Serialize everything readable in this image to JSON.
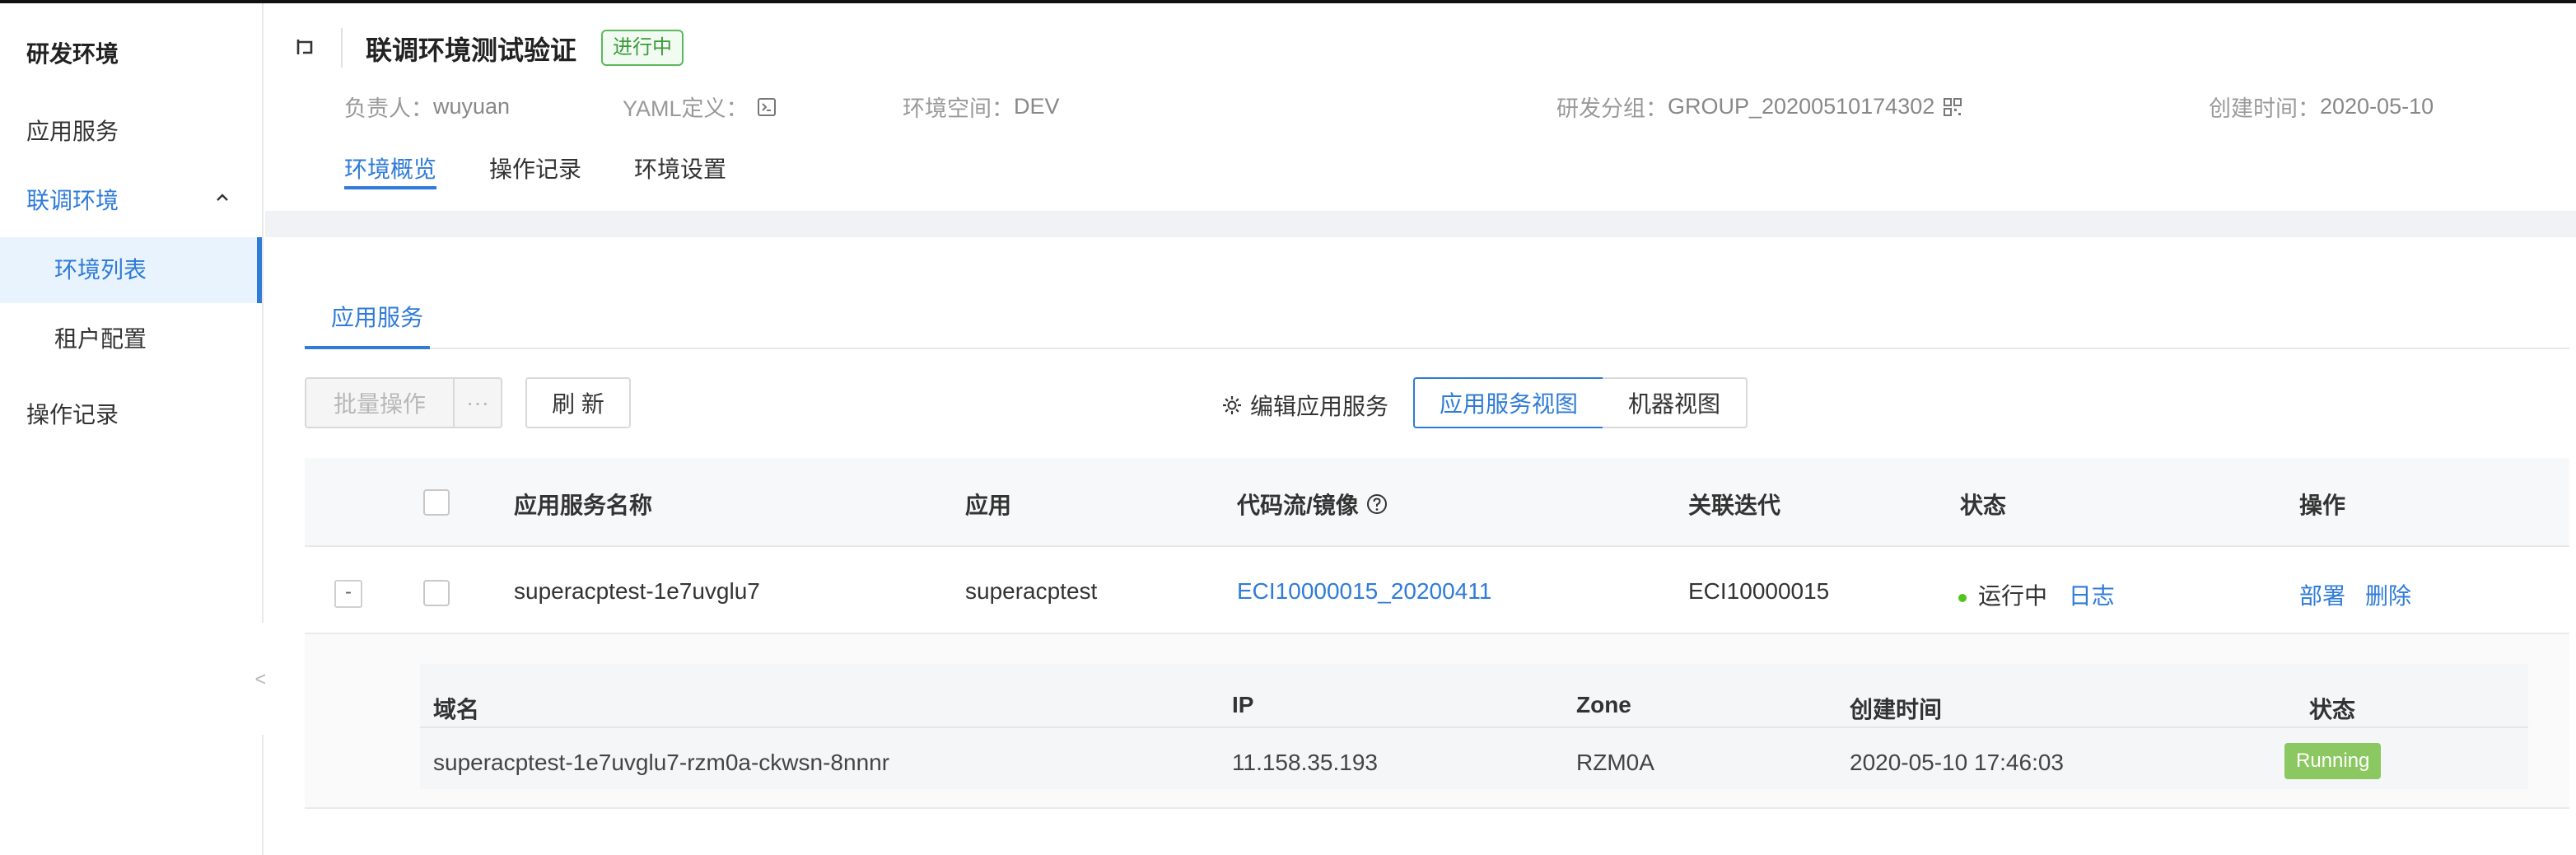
{
  "sidebar": {
    "title": "研发环境",
    "items": [
      {
        "label": "应用服务"
      },
      {
        "label": "联调环境"
      },
      {
        "label": "环境列表"
      },
      {
        "label": "租户配置"
      },
      {
        "label": "操作记录"
      }
    ],
    "collapse_glyph": "<"
  },
  "header": {
    "title": "联调环境测试验证",
    "status": "进行中",
    "meta": {
      "owner_label": "负责人：",
      "owner_value": "wuyuan",
      "yaml_label": "YAML定义：",
      "space_label": "环境空间：",
      "space_value": "DEV",
      "group_label": "研发分组：",
      "group_value": "GROUP_20200510174302",
      "created_label": "创建时间：",
      "created_value": "2020-05-10"
    },
    "tabs": [
      {
        "label": "环境概览"
      },
      {
        "label": "操作记录"
      },
      {
        "label": "环境设置"
      }
    ]
  },
  "content": {
    "sub_tab": "应用服务",
    "toolbar": {
      "batch_label": "批量操作",
      "more_label": "···",
      "refresh_label": "刷 新",
      "edit_label": "编辑应用服务",
      "view_app": "应用服务视图",
      "view_machine": "机器视图"
    },
    "table": {
      "columns": [
        "应用服务名称",
        "应用",
        "代码流/镜像",
        "关联迭代",
        "状态",
        "操作"
      ],
      "rows": [
        {
          "expand": "-",
          "name": "superacptest-1e7uvglu7",
          "app": "superacptest",
          "code": "ECI10000015_20200411",
          "iteration": "ECI10000015",
          "status": "运行中",
          "log": "日志",
          "deploy": "部署",
          "delete": "删除"
        }
      ]
    },
    "detail": {
      "columns": [
        "域名",
        "IP",
        "Zone",
        "创建时间",
        "状态"
      ],
      "rows": [
        {
          "domain": "superacptest-1e7uvglu7-rzm0a-ckwsn-8nnnr",
          "ip": "11.158.35.193",
          "zone": "RZM0A",
          "created": "2020-05-10 17:46:03",
          "status": "Running"
        }
      ]
    }
  },
  "colors": {
    "accent": "#2f7bd8",
    "success": "#52c41a",
    "running_badge": "#8bc861"
  }
}
